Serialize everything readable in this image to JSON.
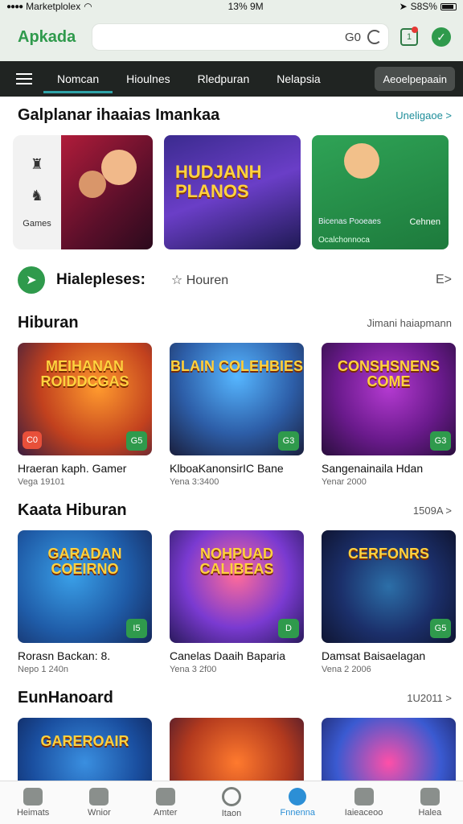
{
  "status_bar": {
    "carrier": "Marketplolex",
    "time": "13% 9M",
    "battery": "S8S%"
  },
  "header": {
    "brand": "Apkada",
    "search_value": "G0",
    "cart_count": "1"
  },
  "navbar": {
    "tabs": [
      "Nomcan",
      "Hioulnes",
      "Rledpuran",
      "Nelapsia"
    ],
    "pill": "Aeoelpepaain"
  },
  "featured": {
    "title": "Galplanar ihaaias Imankaa",
    "link": "Uneligaoe >",
    "side_label": "Games",
    "card2_text": "HUDJANH PLANOS",
    "card3_left": "Bicenas Pooeaes",
    "card3_right": "Cehnen",
    "card3_bottom": "Ocalchonnoca"
  },
  "info_row": {
    "title": "Hialepleses:",
    "subtitle": "Houren",
    "end": "E>"
  },
  "sections": [
    {
      "title": "Hiburan",
      "link": "Jimani haiapmann",
      "items": [
        {
          "name": "Hraeran kaph. Gamer",
          "sub": "Vega 19101",
          "art": "MEIHANAN ROIDDCGAS",
          "badge": "G5",
          "tag": "C0"
        },
        {
          "name": "KlboaKanonsirIC Bane",
          "sub": "Yena 3:3400",
          "art": "BLAIN COLEHBIES",
          "badge": "G3",
          "tag": ""
        },
        {
          "name": "Sangenainaila Hdan",
          "sub": "Yenar 2000",
          "art": "CONSHSNENS COME",
          "badge": "G3",
          "tag": ""
        }
      ]
    },
    {
      "title": "Kaata Hiburan",
      "link": "1509A >",
      "items": [
        {
          "name": "Rorasn Backan: 8.",
          "sub": "Nepo 1 240n",
          "art": "GARADAN COEIRNO",
          "badge": "I5",
          "tag": ""
        },
        {
          "name": "Canelas Daaih Baparia",
          "sub": "Yena 3 2f00",
          "art": "NOHPUAD CALIBEAS",
          "badge": "D",
          "tag": ""
        },
        {
          "name": "Damsat Baisaelagan",
          "sub": "Vena 2 2006",
          "art": "CERFONRS",
          "badge": "G5",
          "tag": ""
        }
      ]
    },
    {
      "title": "EunHanoard",
      "link": "1U2011 >",
      "items": [
        {
          "name": "",
          "sub": "",
          "art": "GAREROAIR",
          "badge": "",
          "tag": ""
        },
        {
          "name": "",
          "sub": "",
          "art": "",
          "badge": "",
          "tag": ""
        },
        {
          "name": "",
          "sub": "",
          "art": "",
          "badge": "",
          "tag": ""
        }
      ]
    }
  ],
  "tabbar": [
    "Heimats",
    "Wnior",
    "Amter",
    "Itaon",
    "Fnnenna",
    "Iaieaceoo",
    "Halea"
  ]
}
